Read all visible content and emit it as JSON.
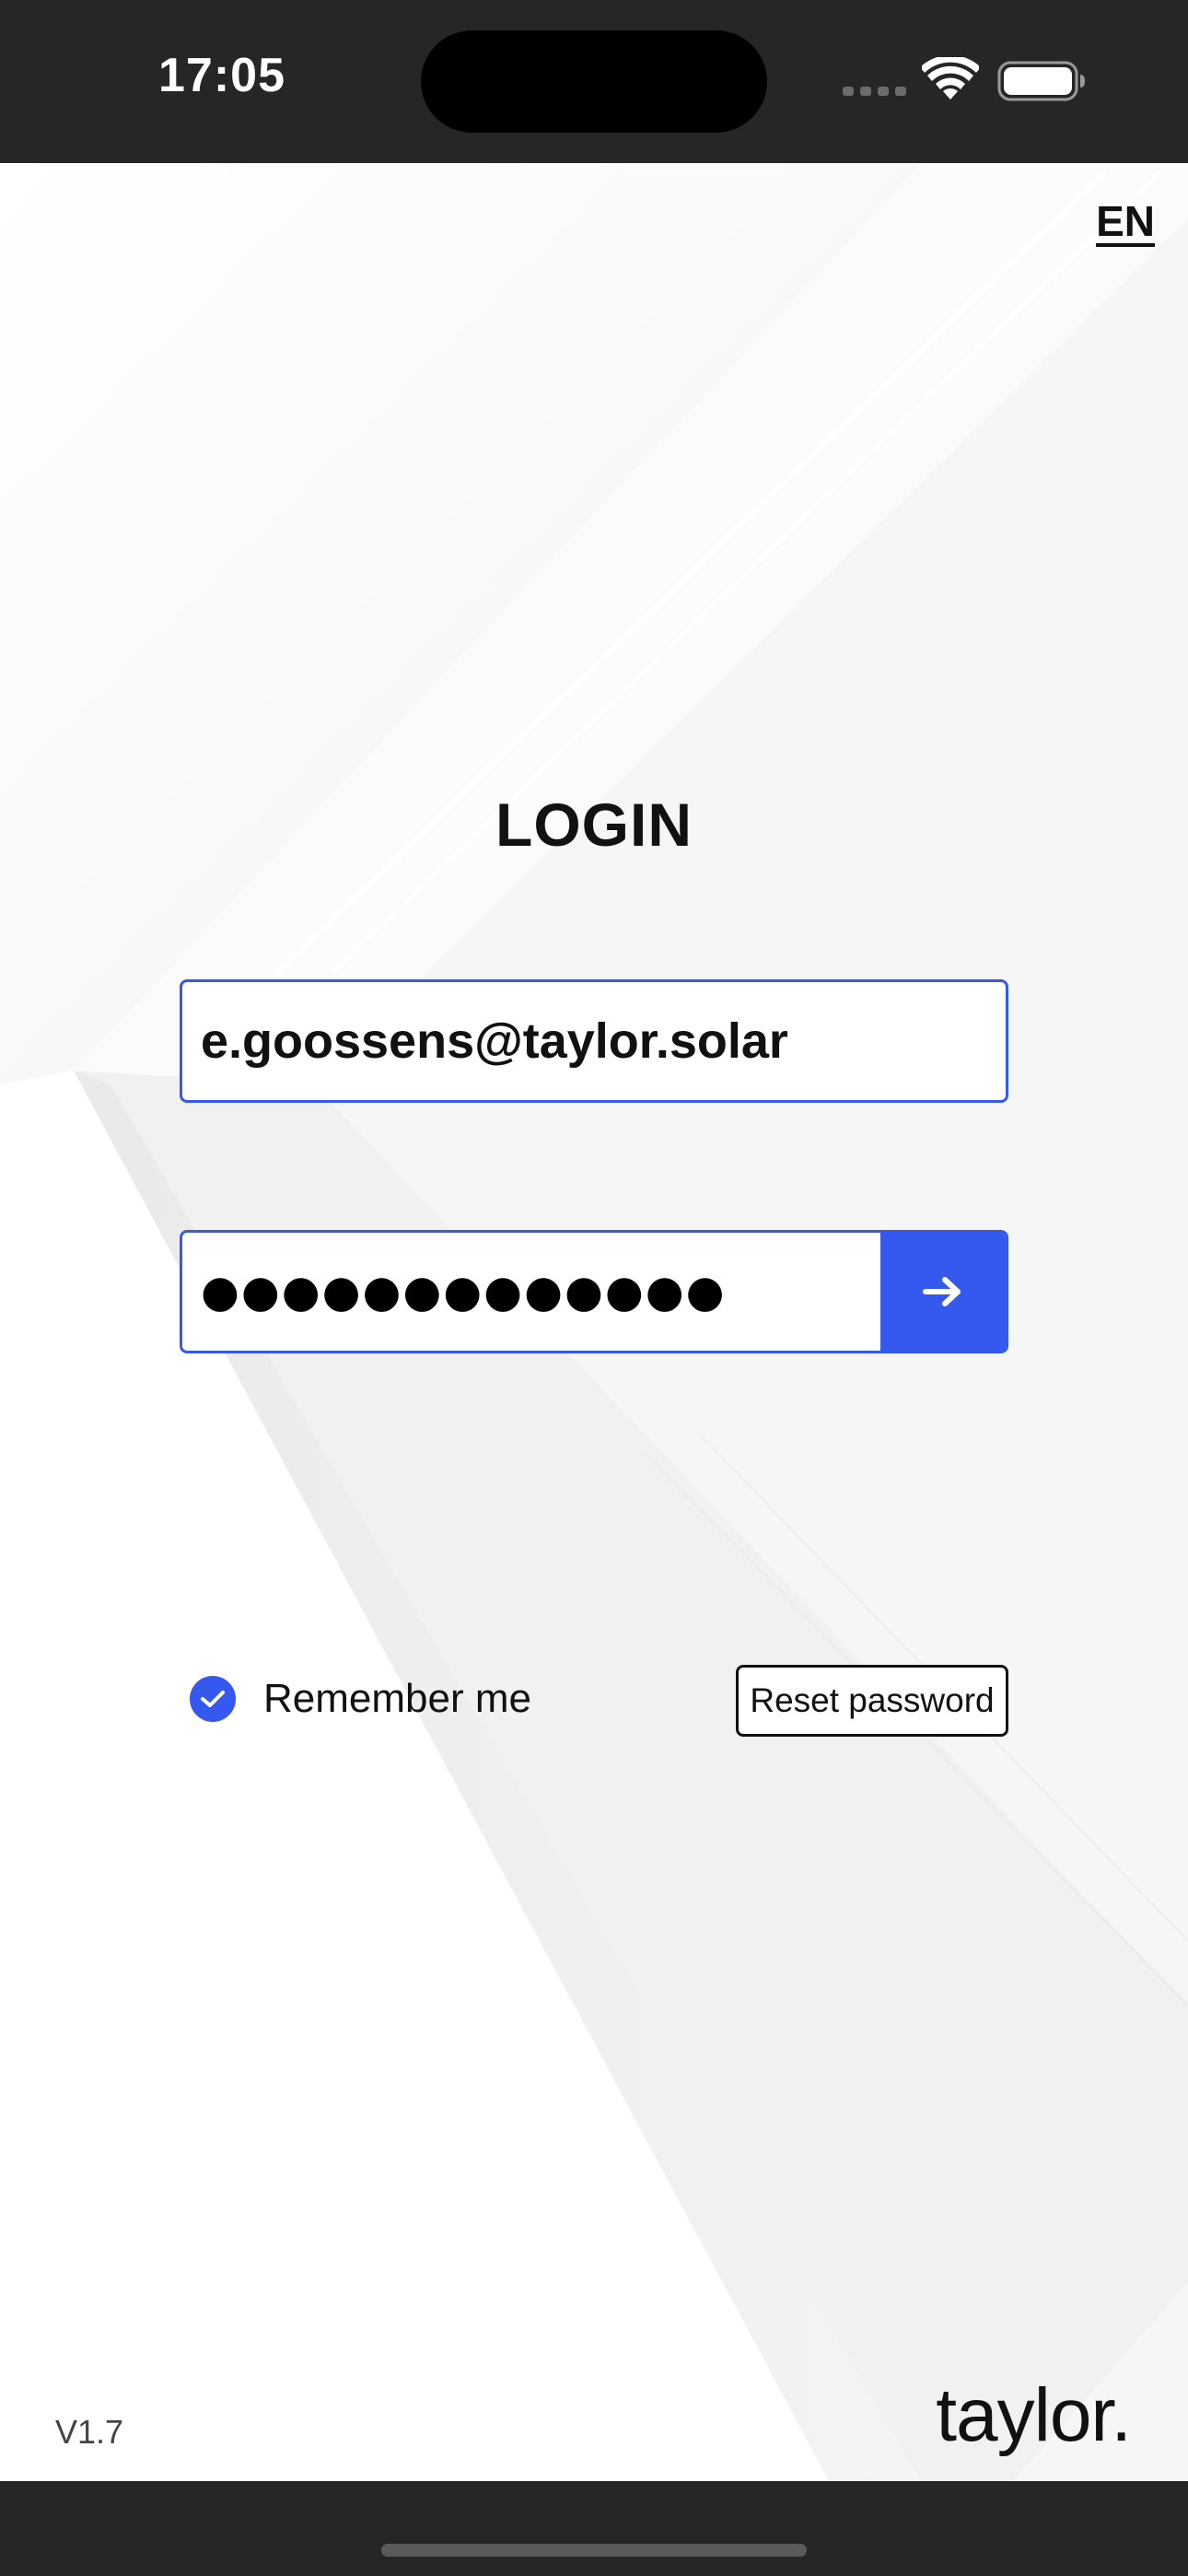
{
  "status_bar": {
    "time": "17:05"
  },
  "header": {
    "language": "EN"
  },
  "login": {
    "title": "LOGIN",
    "email_value": "e.goossens@taylor.solar",
    "password_masked": "●●●●●●●●●●●●●",
    "remember_label": "Remember me",
    "remember_checked": true,
    "reset_label": "Reset password"
  },
  "footer": {
    "version": "V1.7",
    "brand": "taylor."
  },
  "colors": {
    "accent": "#3558ef",
    "text": "#111111",
    "background": "#f7f7f7",
    "system_bar": "#262626"
  },
  "icons": {
    "submit": "arrow-right-icon",
    "remember": "checkmark-icon",
    "status": [
      "signal-icon",
      "wifi-icon",
      "battery-icon"
    ]
  }
}
